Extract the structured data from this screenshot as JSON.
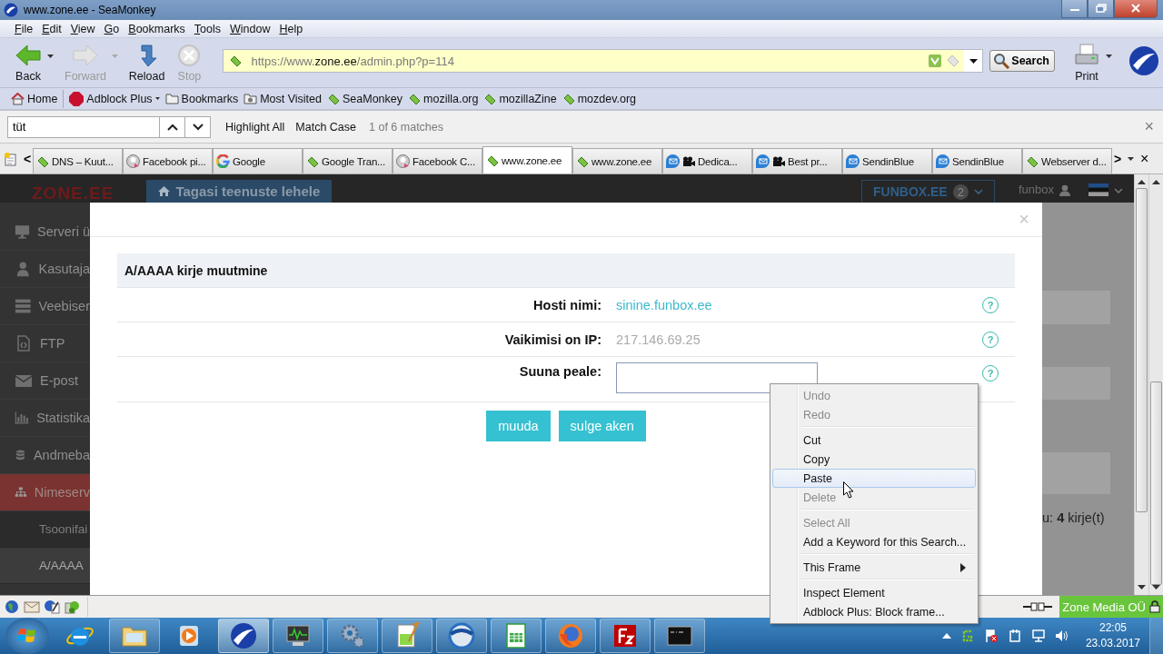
{
  "window": {
    "title": "www.zone.ee - SeaMonkey"
  },
  "menu": [
    "File",
    "Edit",
    "View",
    "Go",
    "Bookmarks",
    "Tools",
    "Window",
    "Help"
  ],
  "nav_buttons": [
    {
      "label": "Back",
      "kind": "back",
      "disabled": false,
      "dropdown": true
    },
    {
      "label": "Forward",
      "kind": "forward",
      "disabled": true,
      "dropdown": true
    },
    {
      "label": "Reload",
      "kind": "reload",
      "disabled": false,
      "dropdown": false
    },
    {
      "label": "Stop",
      "kind": "stop",
      "disabled": true,
      "dropdown": false
    }
  ],
  "address": {
    "value": "https://www.**zone.ee**/admin.php?p=114"
  },
  "search_button": "Search",
  "print_button": "Print",
  "bookmarks": [
    {
      "label": "Home",
      "kind": "home",
      "dropdown": false
    },
    {
      "label": "Adblock Plus",
      "kind": "adblock",
      "dropdown": true
    },
    {
      "label": "Bookmarks",
      "kind": "folder",
      "dropdown": false
    },
    {
      "label": "Most Visited",
      "kind": "picture-folder",
      "dropdown": false
    },
    {
      "label": "SeaMonkey",
      "kind": "tag",
      "dropdown": false
    },
    {
      "label": "mozilla.org",
      "kind": "tag",
      "dropdown": false
    },
    {
      "label": "mozillaZine",
      "kind": "tag",
      "dropdown": false
    },
    {
      "label": "mozdev.org",
      "kind": "tag",
      "dropdown": false
    }
  ],
  "find": {
    "value": "tüt",
    "options": [
      "Highlight All",
      "Match Case"
    ],
    "status": "1 of 6 matches",
    "close": "×"
  },
  "tabs": {
    "scroll_left": "<",
    "scroll_right": ">",
    "close": "×",
    "items": [
      {
        "label": "DNS – Kuut...",
        "kind": "tag",
        "camera": false,
        "selected": false
      },
      {
        "label": "Facebook pi...",
        "kind": "avatar",
        "camera": false,
        "selected": false
      },
      {
        "label": "Google",
        "kind": "google",
        "camera": false,
        "selected": false
      },
      {
        "label": "Google Tran...",
        "kind": "tag",
        "camera": false,
        "selected": false
      },
      {
        "label": "Facebook C...",
        "kind": "avatar",
        "camera": false,
        "selected": false
      },
      {
        "label": "www.zone.ee",
        "kind": "tag",
        "camera": false,
        "selected": true
      },
      {
        "label": "www.zone.ee",
        "kind": "tag",
        "camera": false,
        "selected": false
      },
      {
        "label": "Dedica...",
        "kind": "mail",
        "camera": true,
        "selected": false
      },
      {
        "label": "Best pr...",
        "kind": "mail",
        "camera": true,
        "selected": false
      },
      {
        "label": "SendinBlue",
        "kind": "mail",
        "camera": false,
        "selected": false
      },
      {
        "label": "SendinBlue",
        "kind": "mail",
        "camera": false,
        "selected": false
      },
      {
        "label": "Webserver d...",
        "kind": "tag",
        "camera": false,
        "selected": false
      }
    ]
  },
  "site": {
    "logo": "ZONE.EE",
    "back_button": "Tagasi teenuste lehele",
    "account": {
      "label": "FUNBOX.EE",
      "badge": "2"
    },
    "user": "funbox",
    "sidebar": [
      {
        "label": "Serveri ü",
        "kind": "monitor",
        "selected": false
      },
      {
        "label": "Kasutaja",
        "kind": "user",
        "selected": false
      },
      {
        "label": "Veebiser",
        "kind": "server",
        "selected": false
      },
      {
        "label": "FTP",
        "kind": "file",
        "selected": false
      },
      {
        "label": "E-post",
        "kind": "mail",
        "selected": false
      },
      {
        "label": "Statistika",
        "kind": "chart",
        "selected": false
      },
      {
        "label": "Andmeba",
        "kind": "database",
        "selected": false
      },
      {
        "label": "Nimeserv",
        "kind": "sitemap",
        "selected": true
      },
      {
        "label": "Tsoonifai",
        "kind": "subitem",
        "selected": false
      },
      {
        "label": "A/AAAA",
        "kind": "subitem",
        "selected": true
      }
    ],
    "summary": "u: **4** kirje(t)"
  },
  "dialog": {
    "close": "×",
    "title": "A/AAAA kirje muutmine",
    "fields": [
      {
        "label": "Hosti nimi:",
        "kind": "link",
        "value": "sinine.funbox.ee",
        "help": "?"
      },
      {
        "label": "Vaikimisi on IP:",
        "kind": "text",
        "value": "217.146.69.25",
        "help": "?"
      },
      {
        "label": "Suuna peale:",
        "kind": "input",
        "help": "?"
      }
    ],
    "buttons": [
      "muuda",
      "sulge aken"
    ]
  },
  "context_menu": [
    {
      "kind": "item",
      "label": "Undo",
      "disabled": true,
      "selected": false,
      "submenu": false
    },
    {
      "kind": "item",
      "label": "Redo",
      "disabled": true,
      "selected": false,
      "submenu": false
    },
    {
      "kind": "separator"
    },
    {
      "kind": "item",
      "label": "Cut",
      "disabled": false,
      "selected": false,
      "submenu": false
    },
    {
      "kind": "item",
      "label": "Copy",
      "disabled": false,
      "selected": false,
      "submenu": false
    },
    {
      "kind": "item",
      "label": "Paste",
      "disabled": false,
      "selected": true,
      "submenu": false
    },
    {
      "kind": "item",
      "label": "Delete",
      "disabled": true,
      "selected": false,
      "submenu": false
    },
    {
      "kind": "separator"
    },
    {
      "kind": "item",
      "label": "Select All",
      "disabled": true,
      "selected": false,
      "submenu": false
    },
    {
      "kind": "item",
      "label": "Add a Keyword for this Search...",
      "disabled": false,
      "selected": false,
      "submenu": false
    },
    {
      "kind": "separator"
    },
    {
      "kind": "item",
      "label": "This Frame",
      "disabled": false,
      "selected": false,
      "submenu": true
    },
    {
      "kind": "separator"
    },
    {
      "kind": "item",
      "label": "Inspect Element",
      "disabled": false,
      "selected": false,
      "submenu": false
    },
    {
      "kind": "item",
      "label": "Adblock Plus: Block frame...",
      "disabled": false,
      "selected": false,
      "submenu": false
    }
  ],
  "status_bar": {
    "security": "Zone Media OÜ"
  },
  "taskbar": {
    "apps": [
      {
        "kind": "ie",
        "running": false,
        "active": false
      },
      {
        "kind": "folder",
        "running": true,
        "active": false
      },
      {
        "kind": "media",
        "running": false,
        "active": false
      },
      {
        "kind": "seamonkey",
        "running": true,
        "active": true
      },
      {
        "kind": "monitor",
        "running": true,
        "active": false
      },
      {
        "kind": "gears",
        "running": true,
        "active": false
      },
      {
        "kind": "notepad",
        "running": true,
        "active": false
      },
      {
        "kind": "ring",
        "running": true,
        "active": false
      },
      {
        "kind": "sheet",
        "running": true,
        "active": false
      },
      {
        "kind": "firefox",
        "running": true,
        "active": false
      },
      {
        "kind": "filezilla",
        "running": true,
        "active": false
      },
      {
        "kind": "terminal",
        "running": true,
        "active": false
      }
    ],
    "time": "22:05",
    "date": "23.03.2017"
  }
}
